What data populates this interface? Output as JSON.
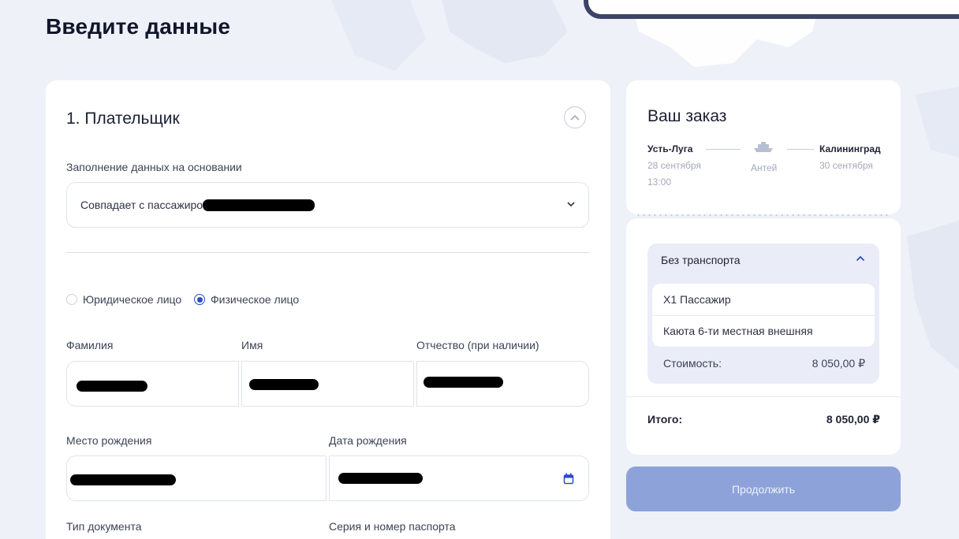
{
  "page": {
    "title": "Введите данные"
  },
  "payer": {
    "section_title": "1. Плательщик",
    "fill_label": "Заполнение данных на основании",
    "fill_value": "Совпадает с пассажиром",
    "payer_types": [
      {
        "label": "Юридическое лицо",
        "checked": false
      },
      {
        "label": "Физическое лицо",
        "checked": true
      }
    ],
    "fields": {
      "last_name": "Фамилия",
      "first_name": "Имя",
      "patronymic": "Отчество (при наличии)",
      "birth_place": "Место рождения",
      "birth_date": "Дата рождения",
      "doc_type": "Тип документа",
      "passport": "Серия и номер паспорта"
    }
  },
  "order": {
    "title": "Ваш заказ",
    "from": {
      "city": "Усть-Луга",
      "date": "28 сентября",
      "time": "13:00"
    },
    "vessel": "Антей",
    "to": {
      "city": "Калининград",
      "date": "30 сентября"
    },
    "ticket": {
      "title": "Без транспорта",
      "items": [
        "X1 Пассажир",
        "Каюта 6-ти местная внешняя"
      ],
      "cost_label": "Стоимость:",
      "cost_value": "8 050,00 ₽"
    },
    "total_label": "Итого:",
    "total_value": "8 050,00 ₽"
  },
  "actions": {
    "continue_label": "Продолжить"
  },
  "colors": {
    "background": "#eef1f8",
    "accent": "#2b4cc7",
    "button": "#8ea2da",
    "ticket_bg": "#eaedf8"
  },
  "icons": {
    "collapse": "chevron-up-icon",
    "select": "chevron-down-icon",
    "calendar": "calendar-icon",
    "ship": "ship-icon"
  }
}
